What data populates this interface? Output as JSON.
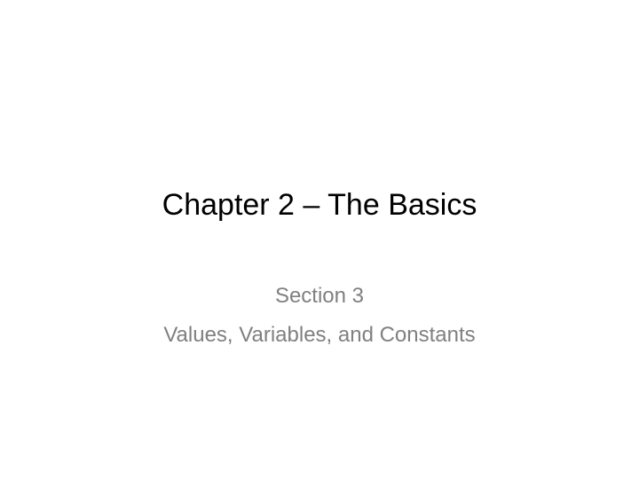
{
  "slide": {
    "title": "Chapter 2 – The Basics",
    "subtitle_lines": [
      "Section 3",
      "Values, Variables, and Constants"
    ]
  },
  "colors": {
    "background": "#ffffff",
    "title": "#000000",
    "subtitle": "#808080"
  }
}
